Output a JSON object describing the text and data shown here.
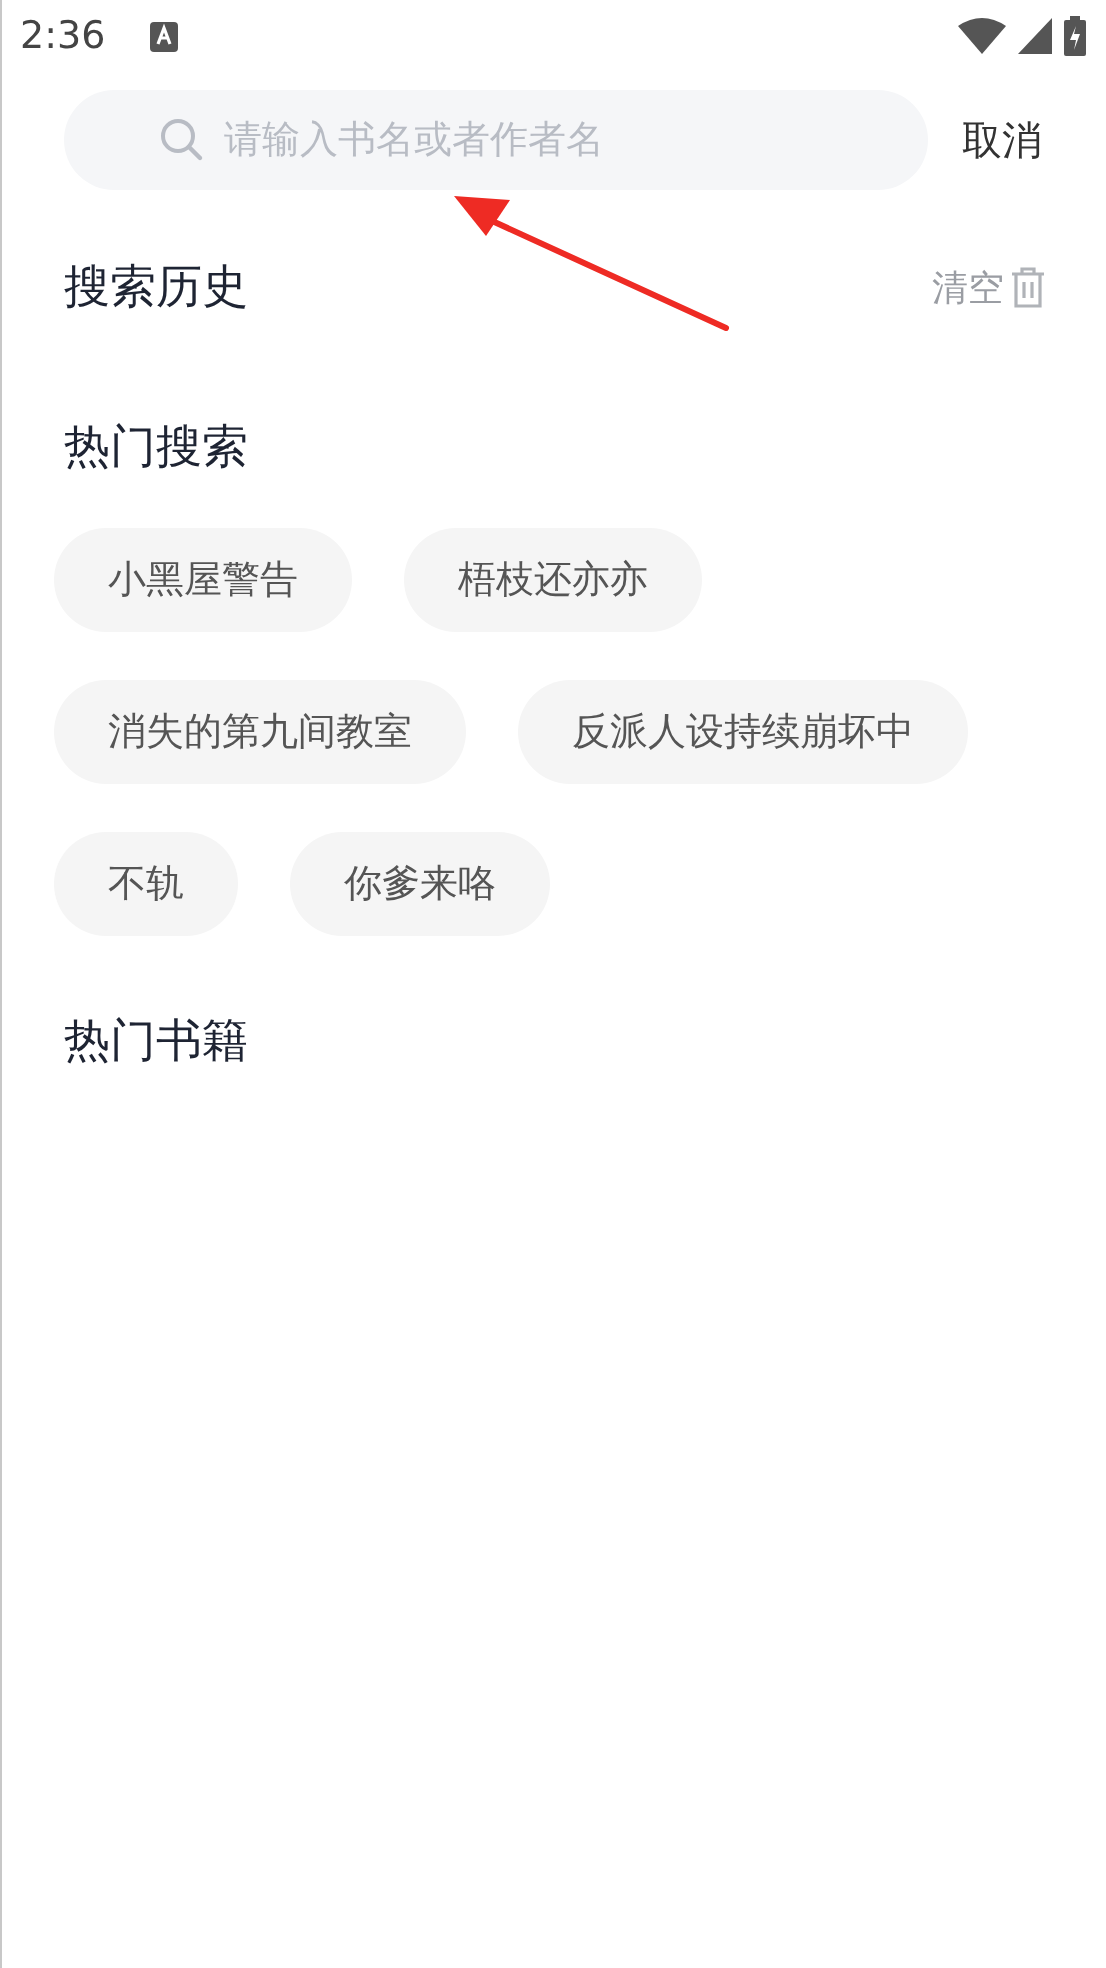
{
  "status_bar": {
    "time": "2:36"
  },
  "search": {
    "placeholder": "请输入书名或者作者名",
    "cancel": "取消"
  },
  "history": {
    "title": "搜索历史",
    "clear": "清空"
  },
  "hot_search": {
    "title": "热门搜索",
    "tags": [
      {
        "label": "小黑屋警告"
      },
      {
        "label": "梧枝还亦亦"
      },
      {
        "label": "消失的第九间教室"
      },
      {
        "label": "反派人设持续崩坏中"
      },
      {
        "label": "不轨"
      },
      {
        "label": "你爹来咯"
      }
    ]
  },
  "hot_books": {
    "title": "热门书籍"
  }
}
